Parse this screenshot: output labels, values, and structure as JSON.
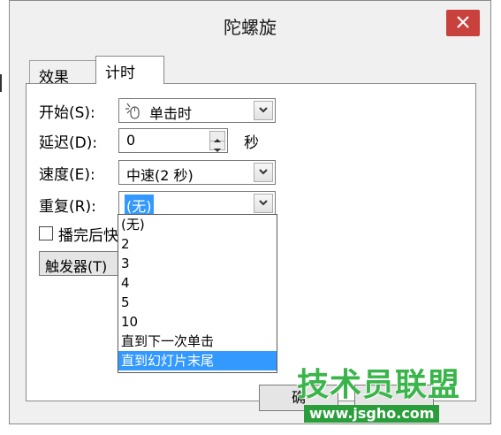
{
  "dialog": {
    "title": "陀螺旋",
    "close_glyph": "×"
  },
  "tabs": [
    {
      "label": "效果"
    },
    {
      "label": "计时"
    }
  ],
  "form": {
    "start_label": "开始(S):",
    "start_value": "单击时",
    "delay_label": "延迟(D):",
    "delay_value": "0",
    "delay_unit": "秒",
    "speed_label": "速度(E):",
    "speed_value": "中速(2 秒)",
    "repeat_label": "重复(R):",
    "repeat_value": "(无)",
    "rewind_label": "播完后快退(W)",
    "rewind_visible": "播完后快",
    "trigger_label": "触发器(T)"
  },
  "repeat_options": [
    "(无)",
    "2",
    "3",
    "4",
    "5",
    "10",
    "直到下一次单击",
    "直到幻灯片末尾"
  ],
  "repeat_highlighted": "直到幻灯片末尾",
  "buttons": {
    "ok_label": "确定",
    "ok_visible": "确",
    "cancel_label": ""
  },
  "watermark": {
    "main": "技术员联盟",
    "url": "www.jsgho.com"
  },
  "colors": {
    "close_button": "#c9413c",
    "selection": "#3399ff",
    "watermark_green": "#39b54a"
  },
  "icons": {
    "start": "mouse-click-icon",
    "dropdown": "chevron-down-icon",
    "spin_up": "arrow-up-icon",
    "spin_down": "arrow-down-icon",
    "close": "close-icon"
  }
}
